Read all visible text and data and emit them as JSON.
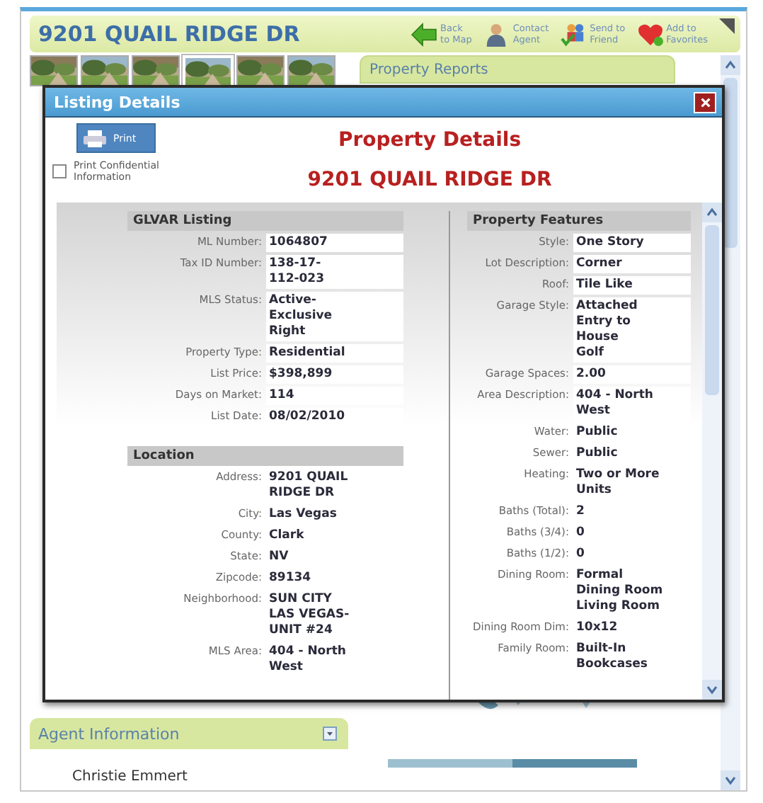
{
  "page": {
    "title": "9201 QUAIL RIDGE DR",
    "actions": [
      {
        "kind": "back",
        "label": "Back\nto Map"
      },
      {
        "kind": "agent",
        "label": "Contact\nAgent"
      },
      {
        "kind": "friend",
        "label": "Send to\nFriend"
      },
      {
        "kind": "favorite",
        "label": "Add to\nFavorites"
      }
    ],
    "thumbnails": [
      {
        "selected": false
      },
      {
        "selected": false
      },
      {
        "selected": false
      },
      {
        "selected": true
      },
      {
        "selected": false
      },
      {
        "selected": false
      }
    ],
    "reports_panel": {
      "title": "Property Reports"
    },
    "agent_panel": {
      "title": "Agent Information",
      "name": "Christie Emmert"
    }
  },
  "dialog": {
    "title": "Listing Details",
    "print_button": "Print",
    "confidential": {
      "label": "Print Confidential Information",
      "checked": false
    },
    "heading": "Property Details",
    "address": "9201 QUAIL RIDGE DR",
    "left_sections": [
      {
        "title": "GLVAR Listing",
        "fields": [
          {
            "label": "ML Number:",
            "value": "1064807"
          },
          {
            "label": "Tax ID Number:",
            "value": "138-17-\n112-023"
          },
          {
            "label": "MLS Status:",
            "value": "Active-\nExclusive\nRight"
          },
          {
            "label": "Property Type:",
            "value": "Residential"
          },
          {
            "label": "List Price:",
            "value": "$398,899"
          },
          {
            "label": "Days on Market:",
            "value": "114"
          },
          {
            "label": "List Date:",
            "value": "08/02/2010"
          }
        ]
      },
      {
        "title": "Location",
        "fields": [
          {
            "label": "Address:",
            "value": "9201 QUAIL\nRIDGE DR"
          },
          {
            "label": "City:",
            "value": "Las Vegas"
          },
          {
            "label": "County:",
            "value": "Clark"
          },
          {
            "label": "State:",
            "value": "NV"
          },
          {
            "label": "Zipcode:",
            "value": "89134"
          },
          {
            "label": "Neighborhood:",
            "value": "SUN CITY\nLAS VEGAS-\nUNIT #24"
          },
          {
            "label": "MLS Area:",
            "value": "404 - North\nWest"
          }
        ]
      }
    ],
    "right_sections": [
      {
        "title": "Property Features",
        "fields": [
          {
            "label": "Style:",
            "value": "One Story"
          },
          {
            "label": "Lot Description:",
            "value": "Corner"
          },
          {
            "label": "Roof:",
            "value": "Tile Like"
          },
          {
            "label": "Garage Style:",
            "value": "Attached\nEntry to\nHouse\nGolf"
          },
          {
            "label": "Garage Spaces:",
            "value": "2.00"
          },
          {
            "label": "Area Description:",
            "value": "404 - North\nWest"
          },
          {
            "label": "Water:",
            "value": "Public"
          },
          {
            "label": "Sewer:",
            "value": "Public"
          },
          {
            "label": "Heating:",
            "value": "Two or More\nUnits"
          },
          {
            "label": "Baths (Total):",
            "value": "2"
          },
          {
            "label": "Baths (3/4):",
            "value": "0"
          },
          {
            "label": "Baths (1/2):",
            "value": "0"
          },
          {
            "label": "Dining Room:",
            "value": "Formal\nDining Room\nLiving Room"
          },
          {
            "label": "Dining Room Dim:",
            "value": "10x12"
          },
          {
            "label": "Family Room:",
            "value": "Built-In\nBookcases"
          }
        ]
      }
    ]
  }
}
